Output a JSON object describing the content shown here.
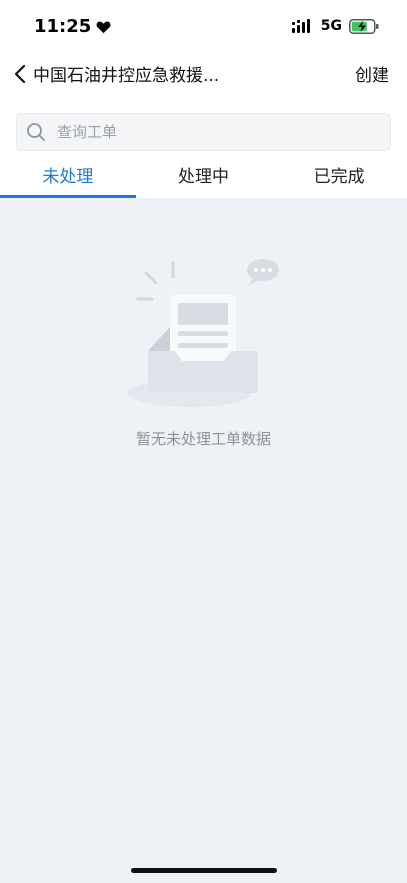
{
  "status_bar": {
    "time": "11:25",
    "network": "5G"
  },
  "nav": {
    "title": "中国石油井控应急救援...",
    "action_label": "创建"
  },
  "search": {
    "placeholder": "查询工单"
  },
  "tabs": [
    {
      "label": "未处理",
      "active": true
    },
    {
      "label": "处理中",
      "active": false
    },
    {
      "label": "已完成",
      "active": false
    }
  ],
  "empty_state": {
    "message": "暂无未处理工单数据"
  },
  "colors": {
    "accent": "#1a7ad6",
    "background": "#eef1f5",
    "battery": "#3ac75d"
  }
}
